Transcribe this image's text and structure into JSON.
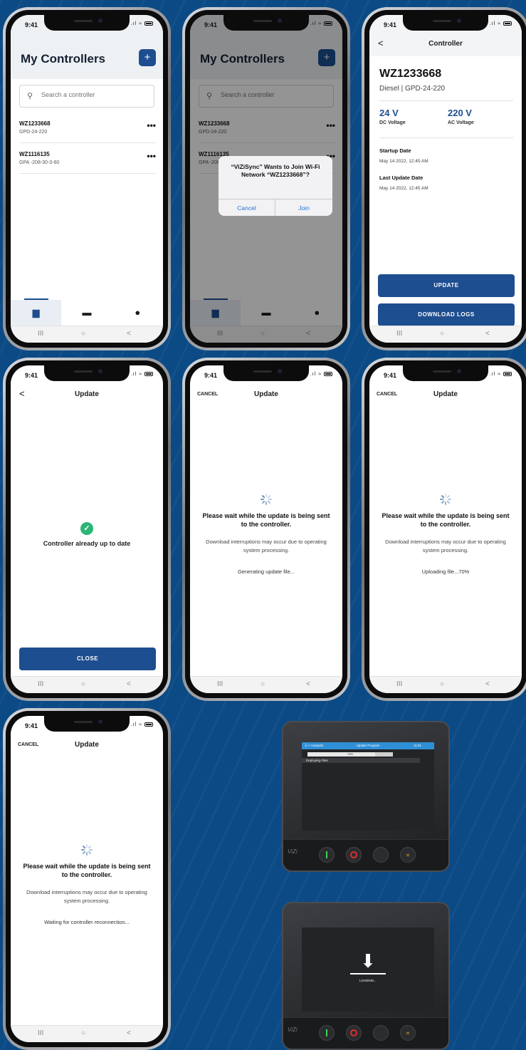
{
  "status_time": "9:41",
  "status_icons": ".ıl ≈",
  "navbar": {
    "recents": "III",
    "home": "○",
    "back": "<"
  },
  "screen1": {
    "title": "My Controllers",
    "add": "+",
    "search_icon": "⚲",
    "search_placeholder": "Search a controller",
    "items": [
      {
        "name": "WZ1233668",
        "model": "GPD-24-220",
        "more": "•••"
      },
      {
        "name": "WZ1116135",
        "model": "GPA -208-30-3-60",
        "more": "•••"
      }
    ],
    "tabs": [
      {
        "icon": "controller-icon",
        "glyph": "▆"
      },
      {
        "icon": "folder-icon",
        "glyph": "▬"
      },
      {
        "icon": "user-icon",
        "glyph": "●"
      }
    ]
  },
  "screen2": {
    "alert_title": "“ViZiSync” Wants to Join Wi-Fi Network “WZ1233668”?",
    "cancel": "Cancel",
    "join": "Join"
  },
  "screen3": {
    "header": "Controller",
    "back": "<",
    "controller_id": "WZ1233668",
    "subtitle": "Diesel | GPD-24-220",
    "dc_value": "24 V",
    "dc_label": "DC Voltage",
    "ac_value": "220 V",
    "ac_label": "AC Voltage",
    "startup_label": "Startup Date",
    "startup_value": "May 14 2022, 12:45 AM",
    "last_update_label": "Last Update Date",
    "last_update_value": "May 14 2022, 12:45 AM",
    "update_btn": "UPDATE",
    "logs_btn": "DOWNLOAD LOGS"
  },
  "screen4": {
    "header": "Update",
    "back": "<",
    "check": "✓",
    "message": "Controller already up to date",
    "close_btn": "CLOSE"
  },
  "update_common": {
    "header": "Update",
    "cancel": "CANCEL",
    "wait": "Please wait while the update is being sent to the controller.",
    "note": "Download interruptions may occur due to operating system processing."
  },
  "screen5": {
    "progress": "Generating update file..."
  },
  "screen6": {
    "progress": "Uploading file...70%"
  },
  "screen7": {
    "progress": "Waiting for controller reconnection..."
  },
  "device1": {
    "bar_left": "☰ < Autopilot",
    "bar_center": "Update Program",
    "bar_right": "11:01",
    "progress_text": "79%",
    "progress": 0.79,
    "files_label": "Deploying Files",
    "brand": "ViZi"
  },
  "device2": {
    "arrow": "⬇",
    "loading": "LOADING...",
    "brand": "ViZi"
  },
  "colors": {
    "primary": "#1d4e8f",
    "background": "#0b4a85",
    "success": "#2bb673"
  }
}
